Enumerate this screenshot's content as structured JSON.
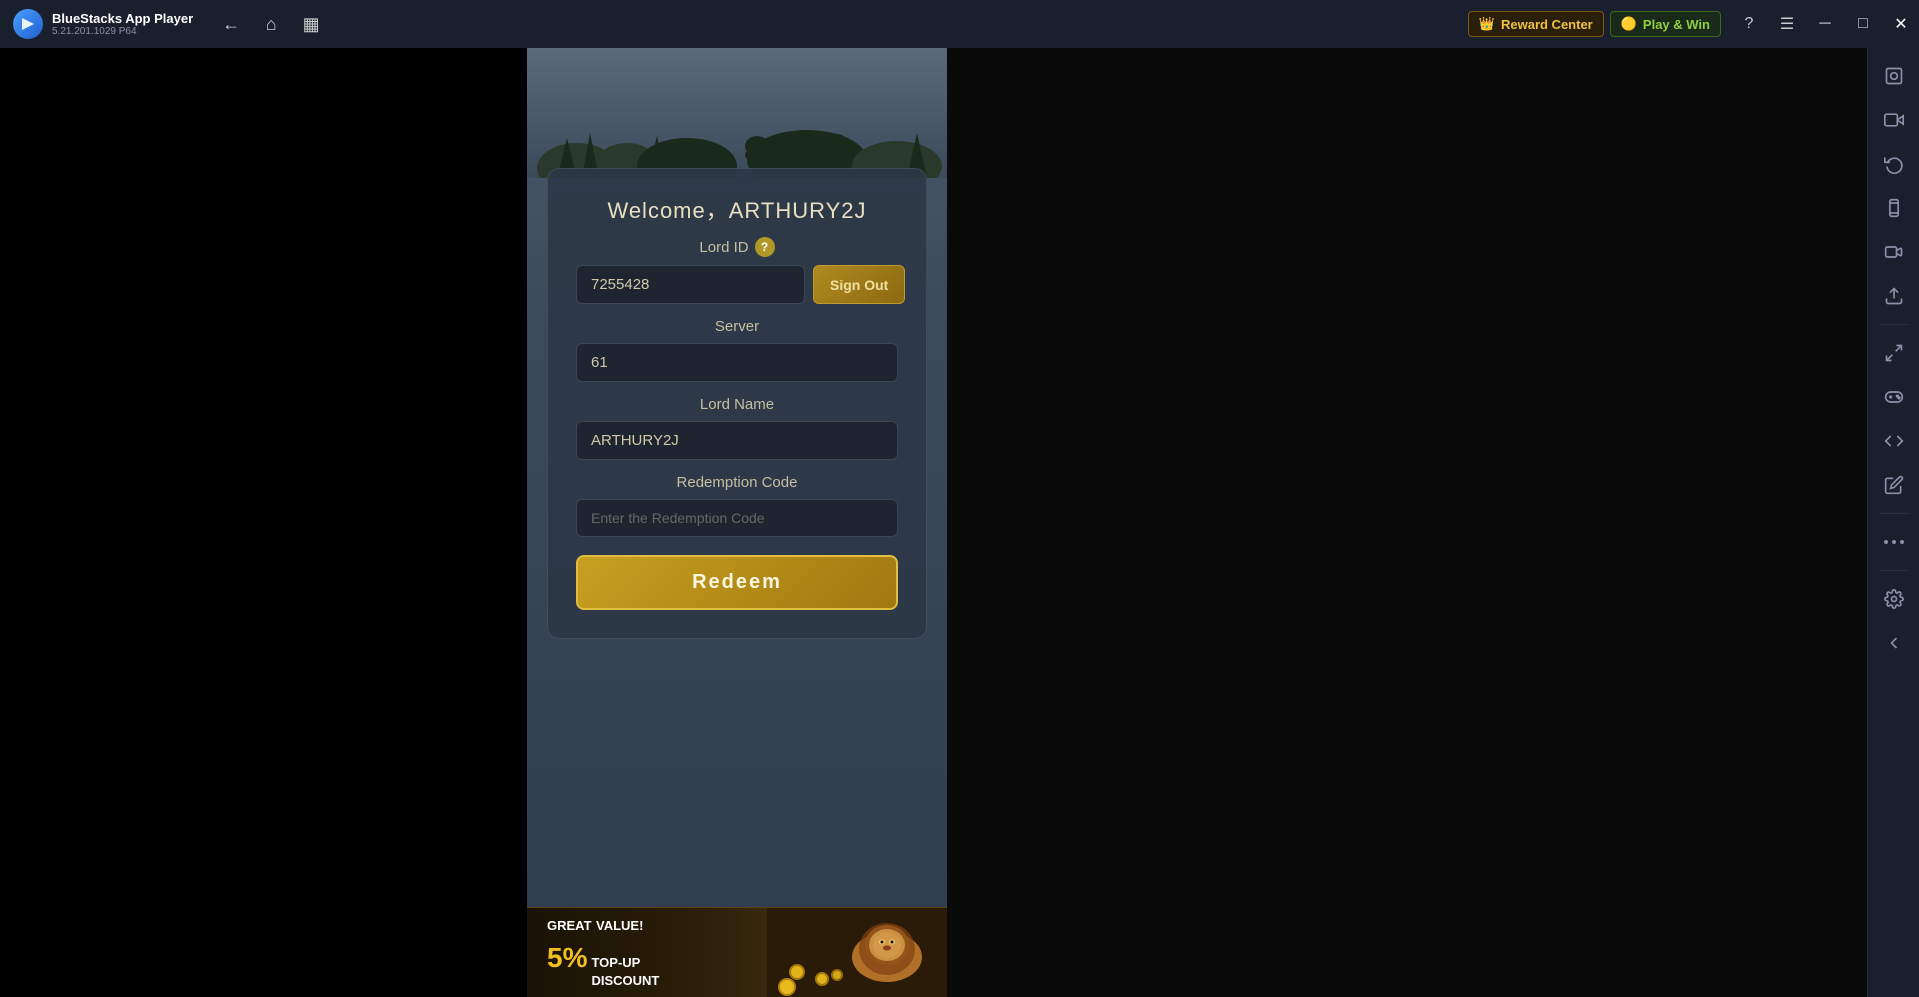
{
  "titlebar": {
    "app_name": "BlueStacks App Player",
    "app_version": "5.21.201.1029  P64",
    "reward_center_label": "Reward Center",
    "play_win_label": "Play & Win",
    "nav": {
      "back_title": "Back",
      "home_title": "Home",
      "multitask_title": "Multitask"
    }
  },
  "game": {
    "welcome_text": "Welcome，ARTHURY2J",
    "lord_id_label": "Lord ID",
    "lord_id_value": "7255428",
    "sign_out_label": "Sign Out",
    "server_label": "Server",
    "server_value": "61",
    "lord_name_label": "Lord Name",
    "lord_name_value": "ARTHURY2J",
    "redemption_code_label": "Redemption Code",
    "redemption_code_placeholder": "Enter the Redemption Code",
    "redeem_button_label": "Redeem",
    "banner": {
      "great_value": "GREAT",
      "value_label": "VALUE!",
      "percent": "5%",
      "topup": "TOP-UP",
      "discount": "DISCOUNT"
    }
  },
  "sidebar": {
    "icons": [
      {
        "name": "settings-icon",
        "symbol": "⚙"
      },
      {
        "name": "screenshot-icon",
        "symbol": "📷"
      },
      {
        "name": "rotate-icon",
        "symbol": "↺"
      },
      {
        "name": "shake-icon",
        "symbol": "📱"
      },
      {
        "name": "camera-icon",
        "symbol": "🎥"
      },
      {
        "name": "apk-icon",
        "symbol": "📦"
      },
      {
        "name": "scale-icon",
        "symbol": "⤢"
      },
      {
        "name": "gamepad-icon",
        "symbol": "🎮"
      },
      {
        "name": "record-icon",
        "symbol": "⏺"
      },
      {
        "name": "edit-icon",
        "symbol": "✏"
      },
      {
        "name": "more-icon",
        "symbol": "•••"
      },
      {
        "name": "gear-icon",
        "symbol": "⚙"
      },
      {
        "name": "back2-icon",
        "symbol": "↩"
      }
    ]
  }
}
